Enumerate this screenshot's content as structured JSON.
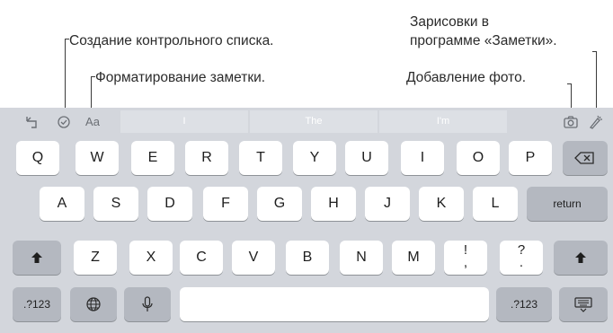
{
  "annotations": {
    "checklist": "Создание контрольного списка.",
    "format": "Форматирование заметки.",
    "sketch_line1": "Зарисовки в",
    "sketch_line2": "программе «Заметки».",
    "photo": "Добавление фото."
  },
  "toolbar": {
    "format_label": "Aa",
    "predictions": [
      "I",
      "The",
      "I'm"
    ]
  },
  "keyboard": {
    "row1": [
      "Q",
      "W",
      "E",
      "R",
      "T",
      "Y",
      "U",
      "I",
      "O",
      "P"
    ],
    "row2": [
      "A",
      "S",
      "D",
      "F",
      "G",
      "H",
      "J",
      "K",
      "L"
    ],
    "row2_return": "return",
    "row3": [
      "Z",
      "X",
      "C",
      "V",
      "B",
      "N",
      "M"
    ],
    "row3_punct1": [
      "!",
      ","
    ],
    "row3_punct2": [
      "?",
      "."
    ],
    "row4_numbers_left": ".?123",
    "row4_numbers_right": ".?123"
  },
  "colors": {
    "keyboard_bg": "#d3d6dc",
    "key": "#ffffff",
    "special_key": "#b4b8c0",
    "icon": "#6b6f75"
  },
  "icons": {
    "undo": "undo-icon",
    "checklist": "checklist-icon",
    "camera": "camera-icon",
    "sketch": "sketch-icon",
    "delete": "delete-icon",
    "shift": "shift-icon",
    "globe": "globe-icon",
    "mic": "mic-icon",
    "hide_keyboard": "hide-keyboard-icon"
  }
}
